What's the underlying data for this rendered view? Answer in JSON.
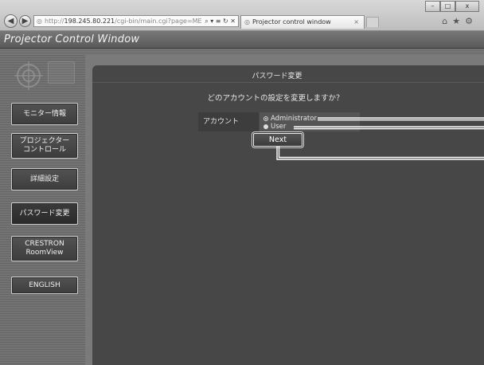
{
  "browser": {
    "address": {
      "scheme": "http://",
      "host": "198.245.80.221",
      "path": "/cgi-bin/main.cgi?page=MENU_I",
      "tools": "⌕ ▾ ≡ ↻ ✕"
    },
    "tab": {
      "label": "Projector control window",
      "close": "×"
    },
    "icons": {
      "back": "back-icon",
      "forward": "forward-icon",
      "home": "home-icon",
      "favorites": "star-icon",
      "settings": "gear-icon"
    },
    "right_icons_text": "⌂★⚙",
    "window_controls": {
      "minimize": "–",
      "maximize": "□",
      "close": "x"
    }
  },
  "app": {
    "title": "Projector Control Window"
  },
  "sidebar": {
    "items": [
      {
        "label": "モニター情報",
        "active": false
      },
      {
        "label": "プロジェクター\nコントロール",
        "active": false
      },
      {
        "label": "詳細設定",
        "active": false
      },
      {
        "label": "パスワード変更",
        "active": true
      },
      {
        "label": "CRESTRON\nRoomView",
        "active": false
      },
      {
        "label": "ENGLISH",
        "active": false
      }
    ]
  },
  "main": {
    "panel_title": "パスワード変更",
    "question": "どのアカウントの設定を変更しますか？",
    "account_label": "アカウント",
    "options": [
      {
        "label": "Administrator",
        "selected": true
      },
      {
        "label": "User",
        "selected": false
      }
    ],
    "next_label": "Next"
  },
  "colors": {
    "panel": "#474747",
    "sidebar": "#6e6e6e",
    "header": "#666666"
  }
}
